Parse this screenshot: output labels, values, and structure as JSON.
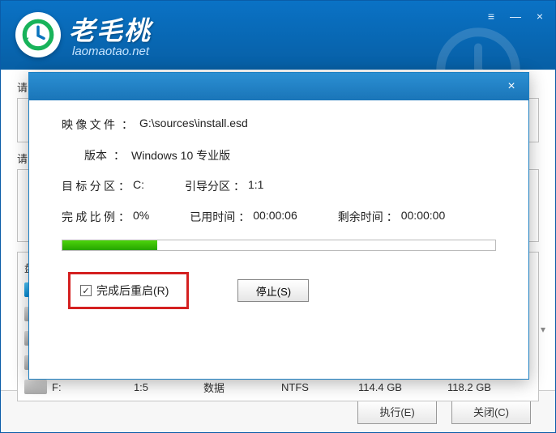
{
  "brand": {
    "name": "老毛桃",
    "url": "laomaotao.net"
  },
  "window_controls": {
    "menu": "≡",
    "min": "—",
    "close": "×"
  },
  "sections": {
    "label1": "请",
    "label2": "请",
    "col_sep": "盘"
  },
  "table_visible_row": {
    "drive": "F:",
    "index": "1:5",
    "type": "数据",
    "fs": "NTFS",
    "total": "114.4 GB",
    "free": "118.2 GB"
  },
  "footer": {
    "execute": "执行(E)",
    "close": "关闭(C)"
  },
  "modal": {
    "image_file_label": "映像文件",
    "image_file_value": "G:\\sources\\install.esd",
    "version_label": "版本",
    "version_value": "Windows 10 专业版",
    "target_label": "目标分区",
    "target_value": "C:",
    "boot_label": "引导分区",
    "boot_value": "1:1",
    "progress_label": "完成比例",
    "progress_value": "0%",
    "elapsed_label": "已用时间",
    "elapsed_value": "00:00:06",
    "remain_label": "剩余时间",
    "remain_value": "00:00:00",
    "restart_label": "完成后重启(R)",
    "stop_label": "停止(S)",
    "close": "×",
    "checkbox_checked": true
  },
  "colors": {
    "header_top": "#0a72c5",
    "header_bottom": "#075fa5",
    "progress": "#26a500",
    "highlight_box": "#d42020"
  }
}
